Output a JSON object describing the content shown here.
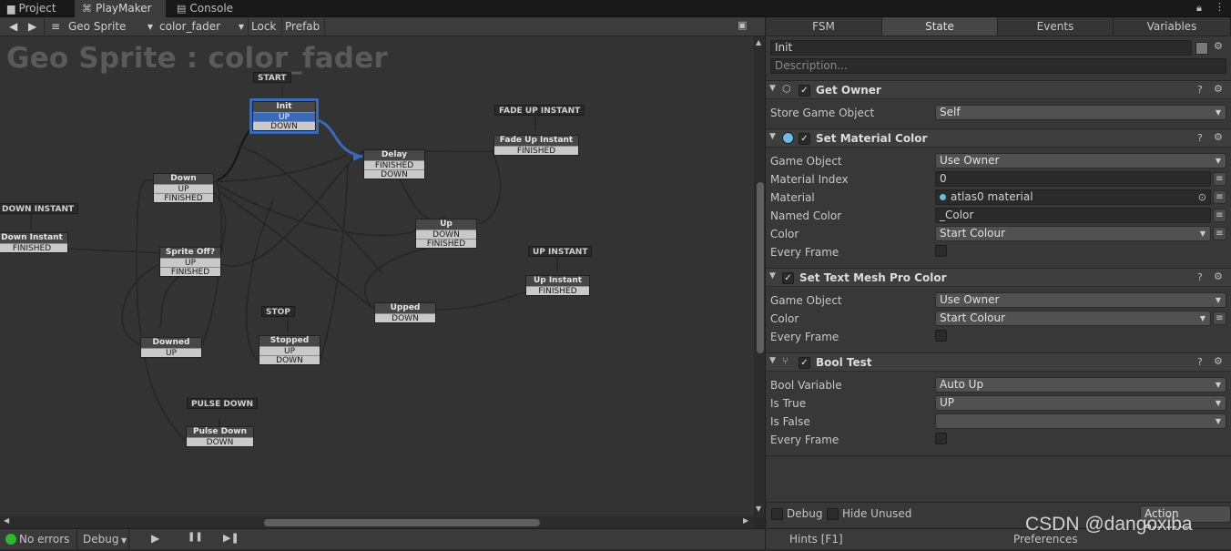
{
  "tabs": [
    {
      "label": "Project"
    },
    {
      "label": "PlayMaker"
    },
    {
      "label": "Console"
    }
  ],
  "toolbar": {
    "back": "◀",
    "forward": "▶",
    "menu": "≡",
    "gameobject": "Geo Sprite",
    "fsm": "color_fader",
    "lock": "Lock",
    "prefab": "Prefab"
  },
  "graph": {
    "title": "Geo Sprite : color_fader",
    "start_event": "START",
    "states": {
      "init": {
        "name": "Init",
        "t": [
          "UP",
          "DOWN"
        ]
      },
      "delay": {
        "name": "Delay",
        "t": [
          "FINISHED",
          "DOWN"
        ]
      },
      "down": {
        "name": "Down",
        "t": [
          "UP",
          "FINISHED"
        ]
      },
      "fade_up_instant": {
        "name": "Fade Up Instant",
        "t": [
          "FINISHED"
        ]
      },
      "up": {
        "name": "Up",
        "t": [
          "DOWN",
          "FINISHED"
        ]
      },
      "down_instant": {
        "name": "Down Instant",
        "t": [
          "FINISHED"
        ]
      },
      "sprite_off": {
        "name": "Sprite Off?",
        "t": [
          "UP",
          "FINISHED"
        ]
      },
      "up_instant": {
        "name": "Up Instant",
        "t": [
          "FINISHED"
        ]
      },
      "upped": {
        "name": "Upped",
        "t": [
          "DOWN"
        ]
      },
      "stopped": {
        "name": "Stopped",
        "t": [
          "UP",
          "DOWN"
        ]
      },
      "downed": {
        "name": "Downed",
        "t": [
          "UP"
        ]
      },
      "pulse_down": {
        "name": "Pulse Down",
        "t": [
          "DOWN"
        ]
      }
    },
    "global_events": {
      "fade_up_instant": "FADE UP INSTANT",
      "down_instant": "DOWN INSTANT",
      "up_instant": "UP INSTANT",
      "stop": "STOP",
      "pulse_down": "PULSE DOWN"
    }
  },
  "statusbar": {
    "errors": "No errors",
    "debug": "Debug",
    "play": "▶",
    "pause": "❚❚",
    "step": "▶❚"
  },
  "inspector": {
    "tabs": [
      "FSM",
      "State",
      "Events",
      "Variables"
    ],
    "active_tab": "State",
    "state_name": "Init",
    "description_placeholder": "Description...",
    "actions": [
      {
        "title": "Get Owner",
        "fields": [
          {
            "label": "Store Game Object",
            "value": "Self"
          }
        ]
      },
      {
        "title": "Set Material Color",
        "fields": [
          {
            "label": "Game Object",
            "value": "Use Owner"
          },
          {
            "label": "Material Index",
            "value": "0"
          },
          {
            "label": "Material",
            "value": "atlas0 material"
          },
          {
            "label": "Named Color",
            "value": "_Color"
          },
          {
            "label": "Color",
            "value": "Start Colour"
          },
          {
            "label": "Every Frame",
            "value": ""
          }
        ]
      },
      {
        "title": "Set Text Mesh Pro Color",
        "fields": [
          {
            "label": "Game Object",
            "value": "Use Owner"
          },
          {
            "label": "Color",
            "value": "Start Colour"
          },
          {
            "label": "Every Frame",
            "value": ""
          }
        ]
      },
      {
        "title": "Bool Test",
        "fields": [
          {
            "label": "Bool Variable",
            "value": "Auto Up"
          },
          {
            "label": "Is True",
            "value": "UP"
          },
          {
            "label": "Is False",
            "value": ""
          },
          {
            "label": "Every Frame",
            "value": ""
          }
        ]
      }
    ],
    "footer": {
      "debug": "Debug",
      "hide_unused": "Hide Unused",
      "action_browser": "Action Browser"
    },
    "status": {
      "hints": "Hints [F1]",
      "preferences": "Preferences"
    }
  },
  "watermark": "CSDN @dangoxiba",
  "colors": {
    "selected": "#3b6bb8",
    "graph_bg": "#333333",
    "panel_bg": "#383838"
  }
}
